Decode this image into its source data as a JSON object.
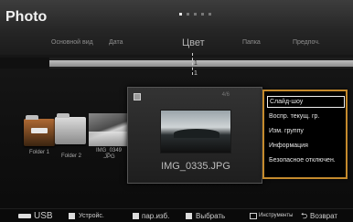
{
  "header": {
    "title": "Photo",
    "page_indicator": {
      "total": 5,
      "active_index": 0
    }
  },
  "sort_tabs": [
    {
      "label": "Основной вид"
    },
    {
      "label": "Дата"
    },
    {
      "label": "Цвет"
    },
    {
      "label": "Папка"
    },
    {
      "label": "Предпоч."
    }
  ],
  "timeline": {
    "count": "1",
    "label": "1"
  },
  "folders": [
    {
      "caption": "Folder 1"
    },
    {
      "caption": "Folder 2"
    }
  ],
  "photos": [
    {
      "caption": "IMG_0349\n.JPG"
    }
  ],
  "preview": {
    "counter": "4/6",
    "filename": "IMG_0335.JPG"
  },
  "context_menu": {
    "items": [
      {
        "label": "Слайд-шоу"
      },
      {
        "label": "Воспр. текущ. гр."
      },
      {
        "label": "Изм. группу"
      },
      {
        "label": "Информация"
      },
      {
        "label": "Безопасное отключен."
      }
    ],
    "active_index": 0
  },
  "bottom_bar": {
    "usb_label": "USB",
    "device_label": "Устройс.",
    "select_folder_label": "пар.изб.",
    "select_label": "Выбрать",
    "tools_label": "Инструменты",
    "return_label": "Возврат"
  },
  "colors": {
    "menu_border": "#c48a2d",
    "selected_folder": "#b06a34"
  },
  "icons": {
    "return": "return-arrow-icon",
    "tools": "tools-icon",
    "usb": "usb-icon"
  }
}
